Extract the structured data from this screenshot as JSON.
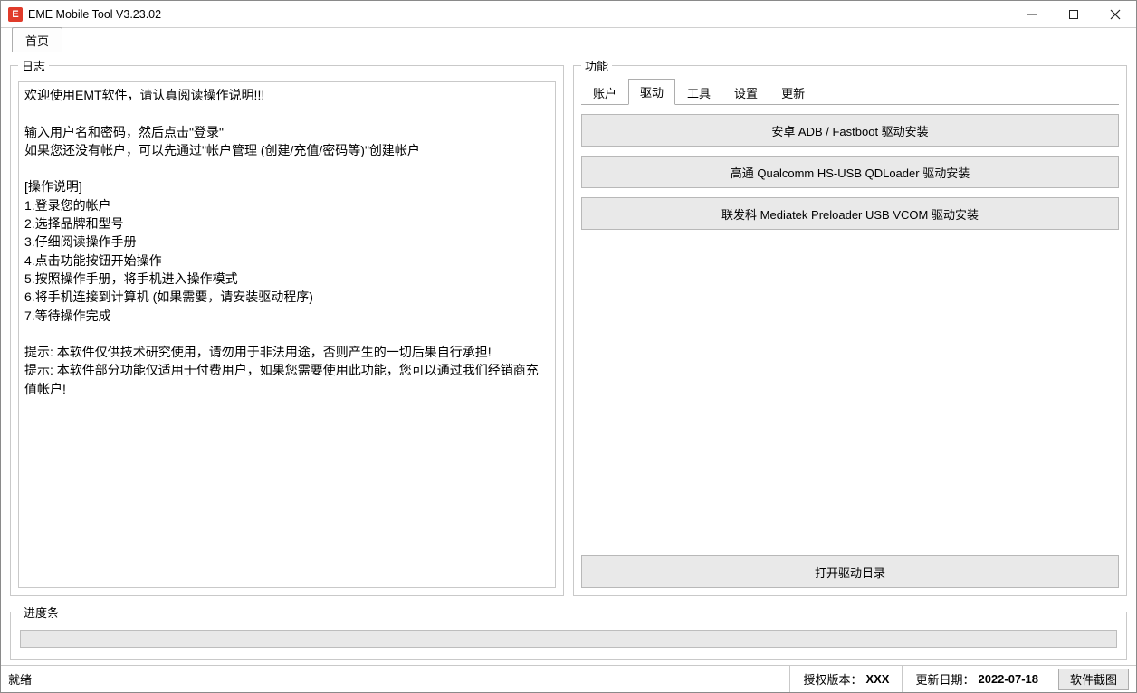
{
  "window": {
    "title": "EME Mobile Tool V3.23.02",
    "icon_letter": "E"
  },
  "main_tabs": {
    "home": "首页"
  },
  "log_panel": {
    "legend": "日志",
    "text": "欢迎使用EMT软件，请认真阅读操作说明!!!\n\n输入用户名和密码，然后点击\"登录\"\n如果您还没有帐户，可以先通过\"帐户管理 (创建/充值/密码等)\"创建帐户\n\n[操作说明]\n1.登录您的帐户\n2.选择品牌和型号\n3.仔细阅读操作手册\n4.点击功能按钮开始操作\n5.按照操作手册，将手机进入操作模式\n6.将手机连接到计算机 (如果需要，请安装驱动程序)\n7.等待操作完成\n\n提示: 本软件仅供技术研究使用，请勿用于非法用途，否则产生的一切后果自行承担!\n提示: 本软件部分功能仅适用于付费用户，如果您需要使用此功能，您可以通过我们经销商充值帐户!"
  },
  "func_panel": {
    "legend": "功能",
    "tabs": {
      "account": "账户",
      "driver": "驱动",
      "tools": "工具",
      "settings": "设置",
      "update": "更新"
    },
    "driver_buttons": {
      "adb": "安卓 ADB / Fastboot 驱动安装",
      "qualcomm": "高通 Qualcomm HS-USB QDLoader 驱动安装",
      "mediatek": "联发科 Mediatek Preloader USB VCOM 驱动安装",
      "open_dir": "打开驱动目录"
    }
  },
  "progress": {
    "legend": "进度条"
  },
  "status": {
    "ready": "就绪",
    "license_label": "授权版本：",
    "license_value": "XXX",
    "update_label": "更新日期：",
    "update_value": "2022-07-18",
    "screenshot_btn": "软件截图"
  }
}
